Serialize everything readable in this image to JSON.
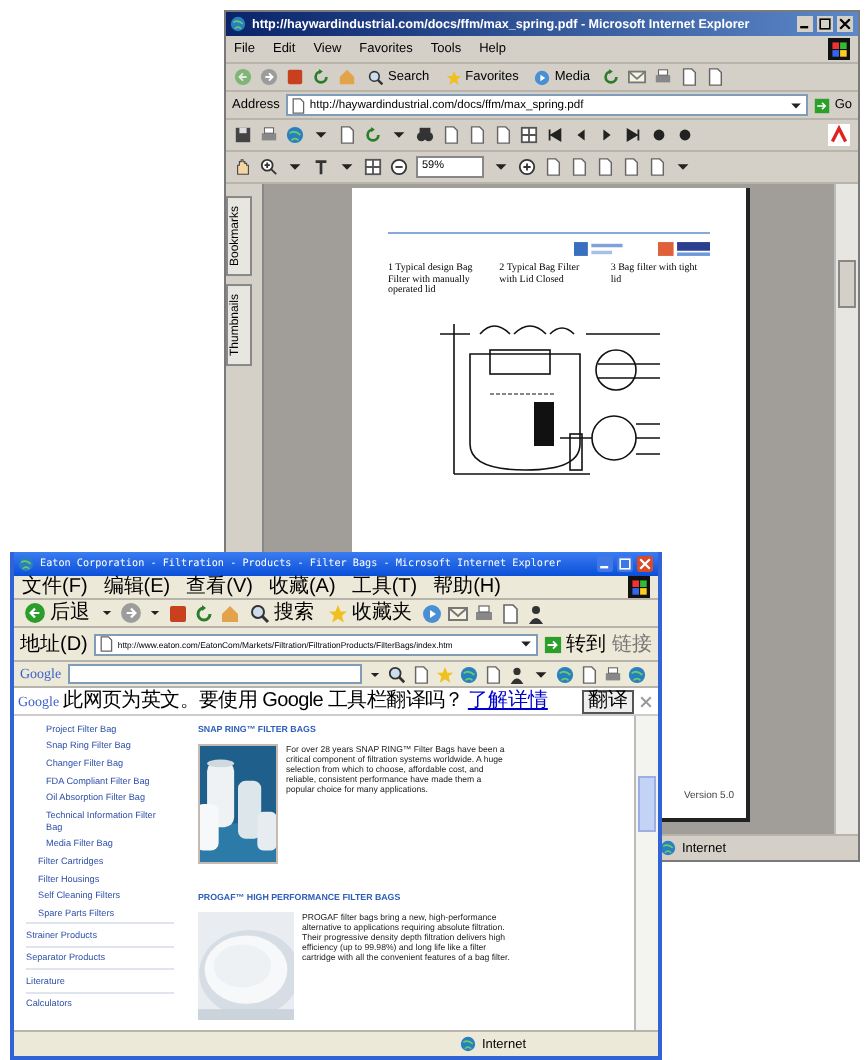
{
  "back_window": {
    "title": "http://haywardindustrial.com/docs/ffm/max_spring.pdf - Microsoft Internet Explorer",
    "menu": [
      "File",
      "Edit",
      "View",
      "Favorites",
      "Tools",
      "Help"
    ],
    "toolbar": [
      "Search",
      "Favorites",
      "Media"
    ],
    "address": {
      "label": "Address",
      "value": "http://haywardindustrial.com/docs/ffm/max_spring.pdf",
      "go": "Go"
    },
    "zoom": {
      "value": "59%"
    },
    "side_tabs": [
      "Bookmarks",
      "Thumbnails"
    ],
    "pdf_page": {
      "captions": [
        "1 Typical design Bag Filter with manually operated lid",
        "2 Typical Bag Filter with Lid Closed",
        "3 Bag filter with tight lid"
      ],
      "footer": "Version 5.0"
    },
    "status_bar": {
      "zone": "Internet"
    }
  },
  "front_window": {
    "title": "Eaton Corporation - Filtration - Products - Filter Bags - Microsoft Internet Explorer",
    "menu": [
      "文件(F)",
      "编辑(E)",
      "查看(V)",
      "收藏(A)",
      "工具(T)",
      "帮助(H)"
    ],
    "toolbar": {
      "back": "后退",
      "search": "搜索",
      "favorites": "收藏夹"
    },
    "address": {
      "label": "地址(D)",
      "value": "http://www.eaton.com/EatonCom/Markets/Filtration/FiltrationProducts/FilterBags/index.htm",
      "go": "转到",
      "links": "链接"
    },
    "google_toolbar": {
      "logo": "Google"
    },
    "notice": {
      "logo": "Google",
      "text": "此网页为英文。要使用 Google 工具栏翻译吗？",
      "link": "了解详情",
      "button": "翻译"
    },
    "nav": [
      {
        "label": "Project Filter Bag",
        "sub": true
      },
      {
        "label": "Snap Ring Filter Bag",
        "sub": true
      },
      {
        "label": "Changer Filter Bag",
        "sub": true
      },
      {
        "label": "FDA Compliant Filter Bag",
        "sub": true
      },
      {
        "label": "Oil Absorption Filter Bag",
        "sub": true
      },
      {
        "label": "Technical Information Filter Bag",
        "sub": true
      },
      {
        "label": "Media Filter Bag",
        "sub": true
      },
      {
        "label": "Filter Cartridges",
        "sub": false
      },
      {
        "label": "Filter Housings",
        "sub": false
      },
      {
        "label": "Self Cleaning Filters",
        "sub": false
      },
      {
        "label": "Spare Parts Filters",
        "sub": false
      }
    ],
    "nav_groups": [
      "Strainer Products",
      "Separator Products",
      "Literature",
      "Calculators"
    ],
    "sections": [
      {
        "heading": "SNAP RING™ FILTER BAGS",
        "text": "For over 28 years SNAP RING™ Filter Bags have been a critical component of filtration systems worldwide. A huge selection from which to choose, affordable cost, and reliable, consistent performance have made them a popular choice for many applications."
      },
      {
        "heading": "PROGAF™ HIGH PERFORMANCE FILTER BAGS",
        "text": "PROGAF filter bags bring a new, high-performance alternative to applications requiring absolute filtration. Their progressive density depth filtration delivers high efficiency (up to 99.98%) and long life like a filter cartridge with all the convenient features of a bag filter."
      }
    ],
    "status_bar": {
      "zone": "Internet"
    }
  }
}
